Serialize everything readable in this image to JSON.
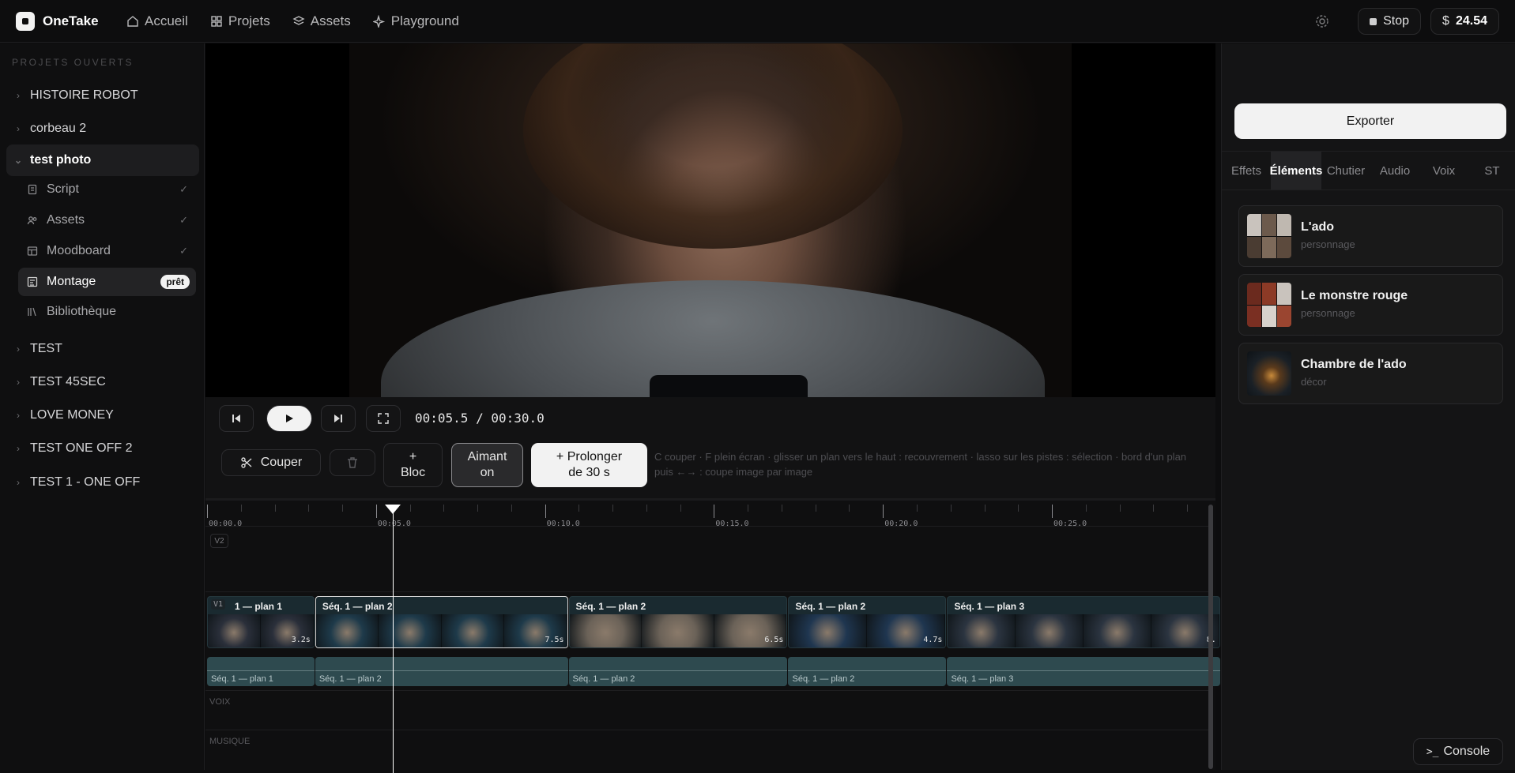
{
  "app": {
    "name": "OneTake"
  },
  "nav": [
    {
      "label": "Accueil",
      "icon": "home-icon"
    },
    {
      "label": "Projets",
      "icon": "grid-icon"
    },
    {
      "label": "Assets",
      "icon": "layers-icon"
    },
    {
      "label": "Playground",
      "icon": "sparkle-icon"
    }
  ],
  "topbar": {
    "stop_label": "Stop",
    "currency": "$",
    "balance": "24.54"
  },
  "sidebar": {
    "heading": "PROJETS OUVERTS",
    "projects_top": [
      "HISTOIRE ROBOT",
      "corbeau 2"
    ],
    "open_project": "test photo",
    "sub_items": [
      {
        "label": "Script",
        "icon": "document-icon",
        "done": "✓"
      },
      {
        "label": "Assets",
        "icon": "users-icon",
        "done": "✓"
      },
      {
        "label": "Moodboard",
        "icon": "board-icon",
        "done": "✓"
      },
      {
        "label": "Montage",
        "icon": "timeline-icon",
        "badge": "prêt"
      },
      {
        "label": "Bibliothèque",
        "icon": "library-icon"
      }
    ],
    "projects_bottom": [
      "TEST",
      "TEST 45SEC",
      "LOVE MONEY",
      "TEST ONE OFF 2",
      "TEST 1 - ONE OFF"
    ]
  },
  "player": {
    "timecode": "00:05.5 / 00:30.0",
    "playhead_seconds": 5.5,
    "duration_seconds": 30
  },
  "tools": {
    "cut": "Couper",
    "add_block": "+ Bloc",
    "magnet": "Aimant on",
    "extend": "+ Prolonger de 30 s",
    "hint": "C couper · F plein écran · glisser un plan vers le haut : recouvrement · lasso sur les pistes : sélection · bord d'un plan puis ←→ : coupe image par image"
  },
  "timeline": {
    "ruler": [
      "00:00.0",
      "00:05.0",
      "00:10.0",
      "00:15.0",
      "00:20.0",
      "00:25.0"
    ],
    "tracks": {
      "v2": "V2",
      "v1": "V1",
      "voice": "VOIX",
      "music": "MUSIQUE"
    },
    "clips": [
      {
        "title": "1 — plan 1",
        "duration": "3.2s",
        "audio": "Séq. 1 — plan 1",
        "start": 0,
        "length": 3.2,
        "color": "#2a2f3a"
      },
      {
        "title": "Séq. 1 — plan 2",
        "duration": "7.5s",
        "audio": "Séq. 1 — plan 2",
        "start": 3.2,
        "length": 7.5,
        "color": "#1e3a4a",
        "selected": true
      },
      {
        "title": "Séq. 1 — plan 2",
        "duration": "6.5s",
        "audio": "Séq. 1 — plan 2",
        "start": 10.7,
        "length": 6.5,
        "color": "#6b6258"
      },
      {
        "title": "Séq. 1 — plan 2",
        "duration": "4.7s",
        "audio": "Séq. 1 — plan 2",
        "start": 17.2,
        "length": 4.7,
        "color": "#1f3650"
      },
      {
        "title": "Séq. 1 — plan 3",
        "duration": "8.",
        "audio": "Séq. 1 — plan 3",
        "start": 21.9,
        "length": 8.1,
        "color": "#2b3440"
      }
    ]
  },
  "right_panel": {
    "export_label": "Exporter",
    "tabs": [
      "Effets",
      "Éléments",
      "Chutier",
      "Audio",
      "Voix",
      "ST"
    ],
    "active_tab": "Éléments",
    "elements": [
      {
        "name": "L'ado",
        "type": "personnage"
      },
      {
        "name": "Le monstre rouge",
        "type": "personnage"
      },
      {
        "name": "Chambre de l'ado",
        "type": "décor"
      }
    ],
    "console_label": "Console",
    "console_prompt": ">_"
  }
}
